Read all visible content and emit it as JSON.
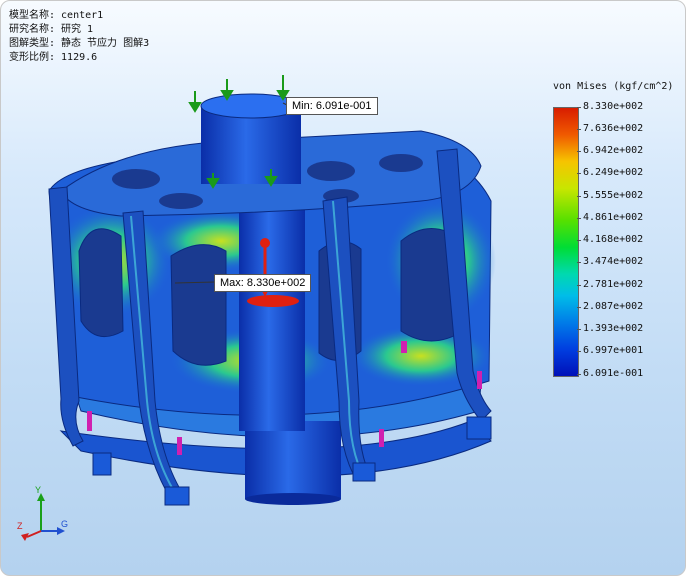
{
  "info": {
    "model_line": "模型名称: center1",
    "study_line": "研究名称: 研究 1",
    "plot_line": "图解类型: 静态 节应力 图解3",
    "scale_line": "变形比例: 1129.6"
  },
  "callouts": {
    "min_label": "Min: 6.091e-001",
    "max_label": "Max: 8.330e+002"
  },
  "legend": {
    "title": "von Mises (kgf/cm^2)",
    "ticks": [
      "8.330e+002",
      "7.636e+002",
      "6.942e+002",
      "6.249e+002",
      "5.555e+002",
      "4.861e+002",
      "4.168e+002",
      "3.474e+002",
      "2.781e+002",
      "2.087e+002",
      "1.393e+002",
      "6.997e+001",
      "6.091e-001"
    ],
    "colors": [
      "#d81d00",
      "#f05a00",
      "#f6c400",
      "#c8e600",
      "#56e000",
      "#00dd35",
      "#00d9b0",
      "#00bde8",
      "#007ce8",
      "#003ee0",
      "#0010b8"
    ]
  },
  "triad": {
    "y_axis": "Y",
    "z_axis": "Z",
    "x_axis": "G",
    "colors": {
      "y": "#1aa01a",
      "x": "#2050d0",
      "z": "#d02020"
    }
  },
  "model": {
    "icons": [
      "force-arrow-icon",
      "fixture-arrow-icon",
      "probe-pin-icon"
    ],
    "colors": {
      "low": "#0a3ec8",
      "mid": "#19b8c8",
      "high": "#d8e020",
      "peak": "#e02010",
      "force": "#1a9a1a",
      "fixture": "#d020b0"
    }
  }
}
